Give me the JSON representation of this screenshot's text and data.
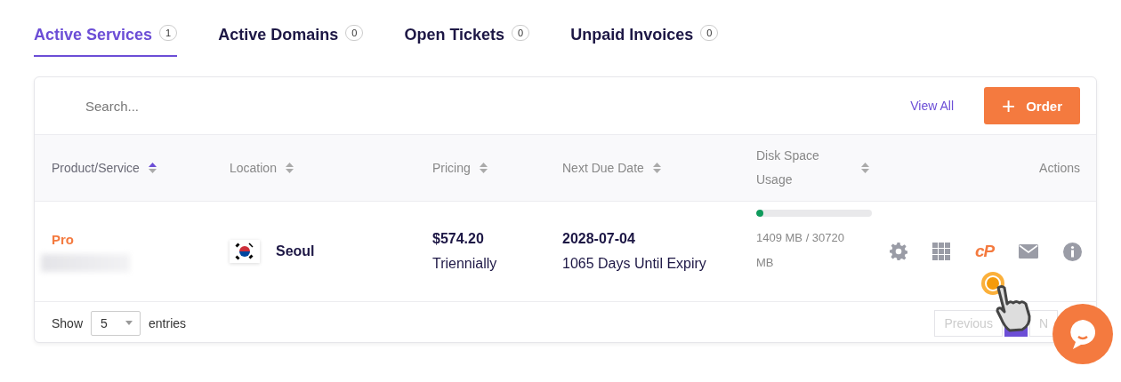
{
  "tabs": [
    {
      "label": "Active Services",
      "count": "1",
      "selected": true
    },
    {
      "label": "Active Domains",
      "count": "0",
      "selected": false
    },
    {
      "label": "Open Tickets",
      "count": "0",
      "selected": false
    },
    {
      "label": "Unpaid Invoices",
      "count": "0",
      "selected": false
    }
  ],
  "search": {
    "placeholder": "Search..."
  },
  "view_all": "View All",
  "order_button": {
    "icon": "+",
    "label": "Order"
  },
  "table": {
    "columns": [
      {
        "label": "Product/Service",
        "sorted": true
      },
      {
        "label": "Location",
        "sorted": false
      },
      {
        "label": "Pricing",
        "sorted": false
      },
      {
        "label": "Next Due Date",
        "sorted": false
      },
      {
        "label": "Disk Space Usage",
        "sorted": false
      },
      {
        "label": "Actions"
      }
    ],
    "rows": [
      {
        "product": "Pro",
        "domain_redacted": true,
        "location": "Seoul",
        "price": "$574.20",
        "cycle": "Triennially",
        "due_date": "2028-07-04",
        "days_left": "1065 Days Until Expiry",
        "disk": {
          "level": 0.046,
          "reading": "1409 MB / 30720 MB"
        },
        "actions": [
          {
            "kind": "gear"
          },
          {
            "kind": "grid"
          },
          {
            "kind": "logo",
            "text": "cP"
          },
          {
            "kind": "mail"
          },
          {
            "kind": "info"
          }
        ]
      }
    ]
  },
  "footer": {
    "show": "Show",
    "page_size": "5",
    "entries": "entries",
    "previous": "Previous",
    "next": "N"
  }
}
